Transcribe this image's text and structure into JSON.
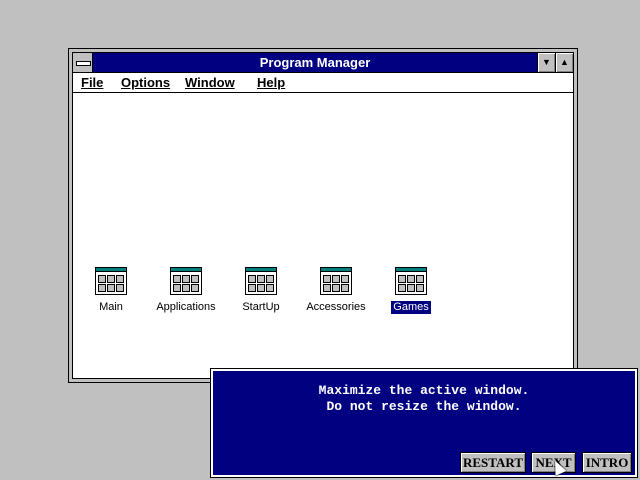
{
  "window": {
    "title": "Program Manager",
    "menu": [
      "File",
      "Options",
      "Window",
      "Help"
    ],
    "minimize_glyph": "▼",
    "maximize_glyph": "▲"
  },
  "groups": [
    {
      "label": "Main",
      "icon": "program-group-icon",
      "selected": false
    },
    {
      "label": "Applications",
      "icon": "program-group-icon",
      "selected": false
    },
    {
      "label": "StartUp",
      "icon": "program-group-icon",
      "selected": false
    },
    {
      "label": "Accessories",
      "icon": "program-group-icon",
      "selected": false
    },
    {
      "label": "Games",
      "icon": "program-group-icon",
      "selected": true
    }
  ],
  "tutorial": {
    "line1": "Maximize the active window.",
    "line2": "Do not resize the window.",
    "buttons": {
      "restart": "RESTART",
      "next": "NEXT",
      "intro": "INTRO"
    }
  },
  "colors": {
    "title_bar": "#000080",
    "desktop": "#c0c0c0",
    "dialog": "#000080",
    "selection": "#000080",
    "group_icon_cap": "#008080"
  }
}
